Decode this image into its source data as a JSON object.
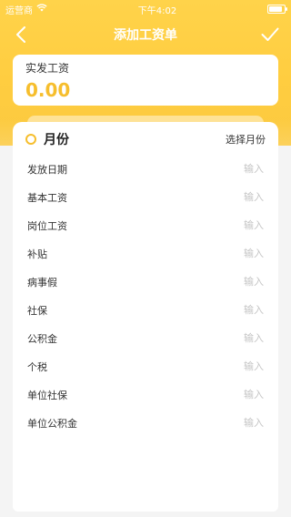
{
  "status_bar": {
    "carrier": "运营商",
    "time": "下午4:02"
  },
  "nav": {
    "title": "添加工资单",
    "back_icon": "chevron-left-icon",
    "confirm_icon": "checkmark-icon"
  },
  "summary": {
    "label": "实发工资",
    "amount": "0.00"
  },
  "month": {
    "label": "月份",
    "select_text": "选择月份"
  },
  "fields": [
    {
      "label": "发放日期",
      "placeholder": "输入"
    },
    {
      "label": "基本工资",
      "placeholder": "输入"
    },
    {
      "label": "岗位工资",
      "placeholder": "输入"
    },
    {
      "label": "补贴",
      "placeholder": "输入"
    },
    {
      "label": "病事假",
      "placeholder": "输入"
    },
    {
      "label": "社保",
      "placeholder": "输入"
    },
    {
      "label": "公积金",
      "placeholder": "输入"
    },
    {
      "label": "个税",
      "placeholder": "输入"
    },
    {
      "label": "单位社保",
      "placeholder": "输入"
    },
    {
      "label": "单位公积金",
      "placeholder": "输入"
    }
  ],
  "colors": {
    "accent": "#f6be2d",
    "header": "#ffd34a"
  }
}
